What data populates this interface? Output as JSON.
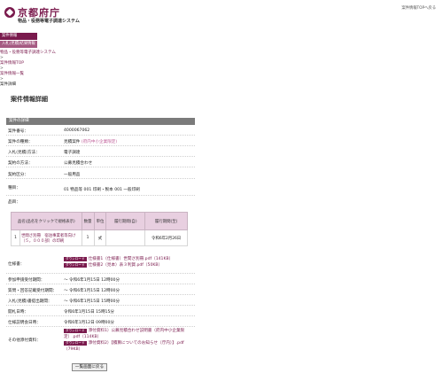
{
  "header": {
    "logo_text": "京都府庁",
    "system_title": "物品・役務等電子調達システム",
    "top_link": "案件情報TOPへ戻る"
  },
  "nav": {
    "items": [
      "案件情報",
      "入札(見積)結果情報"
    ]
  },
  "breadcrumb": {
    "home": "物品・役務等電子調達システム",
    "sep": ">",
    "top": "案件情報TOP",
    "list": "案件情報一覧",
    "current": "案件詳細"
  },
  "page_title": "案件情報詳細",
  "section_title": "案件の詳細",
  "details": {
    "case_no_label": "案件番号：",
    "case_no": "4000067062",
    "case_type_label": "案件の種類：",
    "case_type": "見積案件",
    "case_type_link": "(府内中小企業限定)",
    "method_label": "入札(見積)方法：",
    "method": "電子調達",
    "contract_label": "契約の方法：",
    "contract": "公募見積合わせ",
    "category_label": "契約区分：",
    "category": "一般用品",
    "type_label": "種目：",
    "type": "01 物品等 001 印刷・製本 001 一般印刷",
    "product_label": "品目："
  },
  "items_table": {
    "headers": [
      "品名(品名をクリックで規格表示)",
      "数量",
      "単位",
      "履行期間(自)",
      "履行期間(至)"
    ],
    "rows": [
      {
        "no": "1",
        "name": "世間さ別冊　宿泊事業者等向け（５，０００部）の印刷",
        "qty": "1",
        "unit": "式",
        "from": "",
        "to": "令和6年2月26日"
      }
    ]
  },
  "specs": {
    "label": "仕様書：",
    "badge": "ダウンロード",
    "files": [
      "仕様書1（仕様書）世間さ別冊.pdf（141KB）",
      "仕様書2（見本）表３利賀.pdf（50KB）"
    ]
  },
  "schedule": [
    {
      "label": "参加申請受付期間：",
      "value": "〜 令和6年1月15日 12時00分"
    },
    {
      "label": "質問・回答記載受付期間：",
      "value": "〜 令和6年1月15日 12時00分"
    },
    {
      "label": "入札(見積)書提出期間：",
      "value": "〜 令和6年1月15日 15時00分"
    },
    {
      "label": "開札日時：",
      "value": "令和6年1月15日 15時15分"
    },
    {
      "label": "仕様説明会日時：",
      "value": "令和6年1月12日 09時00分"
    }
  ],
  "other": {
    "label": "その他添付資料：",
    "badge": "ダウンロード",
    "files": [
      "添付資料1）公募見積合わせ説明書（府内中小企業限定）.pdf（114KB）",
      "添付資料2）【積算についてのお知らせ（庁内）】.pdf（79KB）"
    ]
  },
  "back_button": "一覧画面に戻る"
}
